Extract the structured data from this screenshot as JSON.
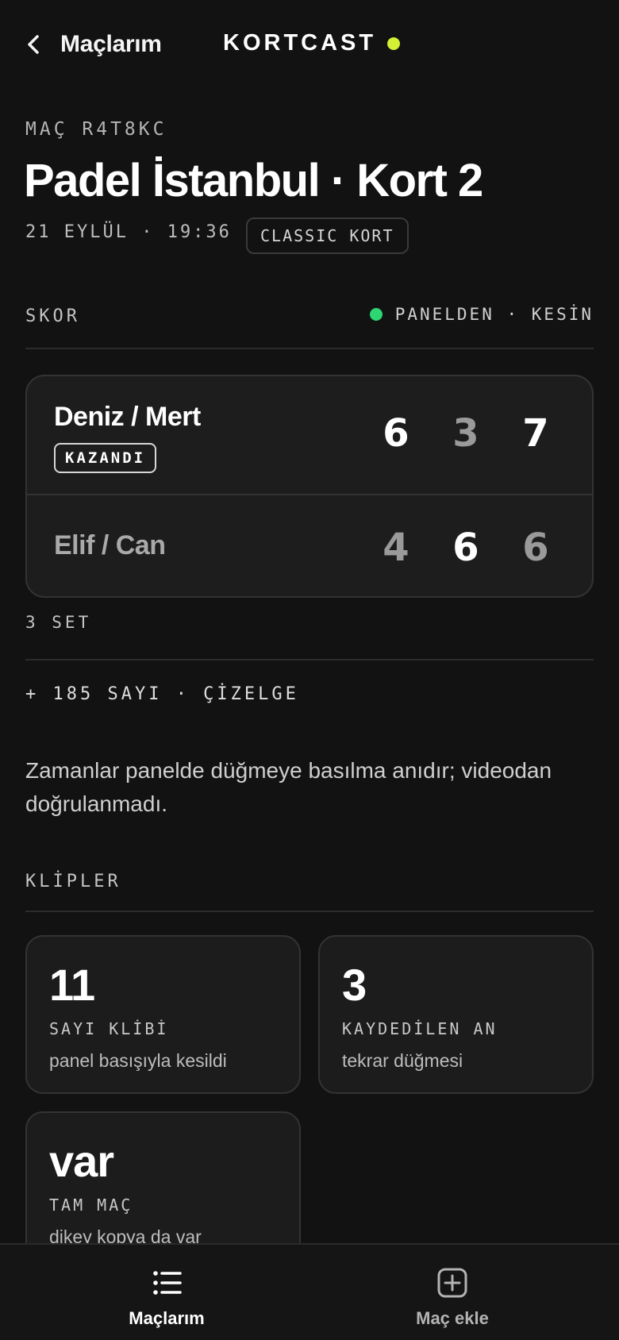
{
  "header": {
    "back_label": "Maçlarım",
    "brand": "KORTCAST"
  },
  "match": {
    "id": "MAÇ R4T8KC",
    "title": "Padel İstanbul · Kort 2",
    "date_time": "21 EYLÜL · 19:36",
    "court_type": "CLASSIC KORT"
  },
  "score": {
    "label": "SKOR",
    "source": "PANELDEN · KESİN",
    "teams": [
      {
        "name": "Deniz / Mert",
        "badge": "KAZANDI",
        "sets": [
          "6",
          "3",
          "7"
        ],
        "set_won": [
          true,
          false,
          true
        ]
      },
      {
        "name": "Elif / Can",
        "badge": "",
        "sets": [
          "4",
          "6",
          "6"
        ],
        "set_won": [
          false,
          true,
          false
        ]
      }
    ],
    "set_count": "3 SET",
    "points_link": "+ 185 SAYI · ÇİZELGE"
  },
  "note": "Zamanlar panelde düğmeye basılma anıdır; videodan doğrulanmadı.",
  "clips": {
    "label": "KLİPLER",
    "cards": [
      {
        "value": "11",
        "label": "SAYI KLİBİ",
        "desc": "panel basışıyla kesildi"
      },
      {
        "value": "3",
        "label": "KAYDEDİLEN AN",
        "desc": "tekrar düğmesi"
      },
      {
        "value": "var",
        "label": "TAM MAÇ",
        "desc": "dikey kopya da var"
      }
    ]
  },
  "nav": {
    "items": [
      {
        "label": "Maçlarım",
        "icon": "list-icon",
        "active": true
      },
      {
        "label": "Maç ekle",
        "icon": "add-square-icon",
        "active": false
      }
    ]
  },
  "colors": {
    "background": "#121212",
    "brand_accent": "#d4f035",
    "status_green": "#2ed573"
  }
}
